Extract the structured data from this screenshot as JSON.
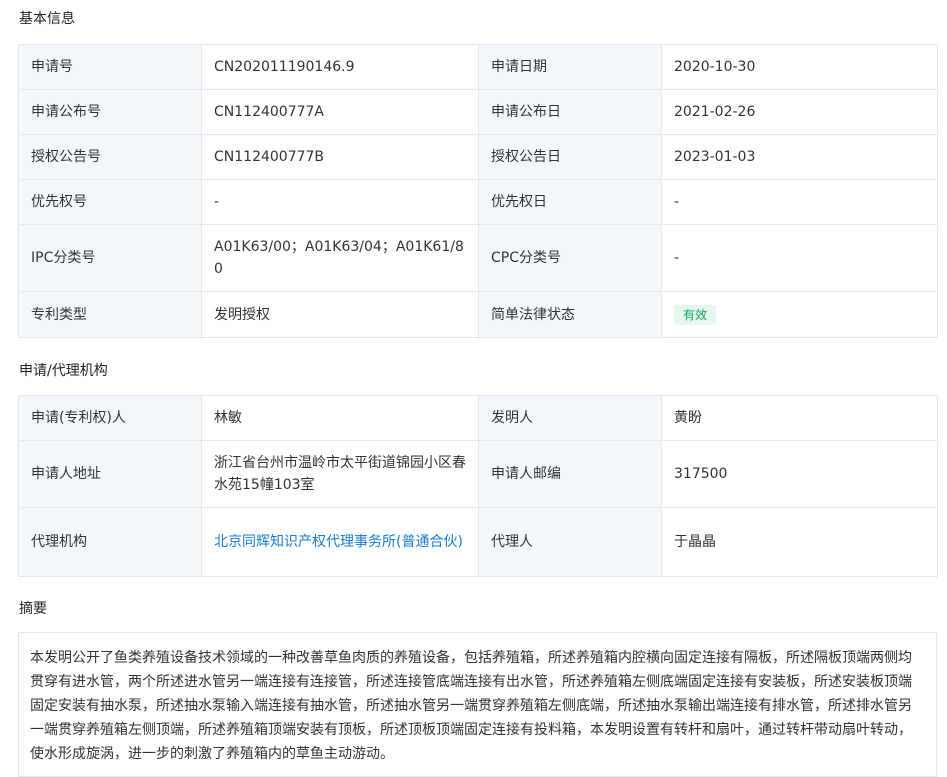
{
  "basic_info": {
    "title": "基本信息",
    "rows": [
      {
        "label1": "申请号",
        "value1": "CN202011190146.9",
        "label2": "申请日期",
        "value2": "2020-10-30"
      },
      {
        "label1": "申请公布号",
        "value1": "CN112400777A",
        "label2": "申请公布日",
        "value2": "2021-02-26"
      },
      {
        "label1": "授权公告号",
        "value1": "CN112400777B",
        "label2": "授权公告日",
        "value2": "2023-01-03"
      },
      {
        "label1": "优先权号",
        "value1": "-",
        "label2": "优先权日",
        "value2": "-"
      },
      {
        "label1": "IPC分类号",
        "value1": "A01K63/00；A01K63/04；A01K61/80",
        "label2": "CPC分类号",
        "value2": "-"
      },
      {
        "label1": "专利类型",
        "value1": "发明授权",
        "label2": "简单法律状态",
        "value2": "有效"
      }
    ],
    "status_color": "#16a25a"
  },
  "agency_info": {
    "title": "申请/代理机构",
    "rows": [
      {
        "label1": "申请(专利权)人",
        "value1": "林敏",
        "label2": "发明人",
        "value2": "黄盼"
      },
      {
        "label1": "申请人地址",
        "value1": "浙江省台州市温岭市太平街道锦园小区春水苑15幢103室",
        "label2": "申请人邮编",
        "value2": "317500"
      },
      {
        "label1": "代理机构",
        "value1": "北京同辉知识产权代理事务所(普通合伙)",
        "label2": "代理人",
        "value2": "于晶晶"
      }
    ],
    "link_color": "#1a7bd3"
  },
  "abstract": {
    "title": "摘要",
    "text": "本发明公开了鱼类养殖设备技术领域的一种改善草鱼肉质的养殖设备，包括养殖箱，所述养殖箱内腔横向固定连接有隔板，所述隔板顶端两侧均贯穿有进水管，两个所述进水管另一端连接有连接管，所述连接管底端连接有出水管，所述养殖箱左侧底端固定连接有安装板，所述安装板顶端固定安装有抽水泵，所述抽水泵输入端连接有抽水管，所述抽水管另一端贯穿养殖箱左侧底端，所述抽水泵输出端连接有排水管，所述排水管另一端贯穿养殖箱左侧顶端，所述养殖箱顶端安装有顶板，所述顶板顶端固定连接有投料箱，本发明设置有转杆和扇叶，通过转杆带动扇叶转动，使水形成旋涡，进一步的刺激了养殖箱内的草鱼主动游动。"
  }
}
